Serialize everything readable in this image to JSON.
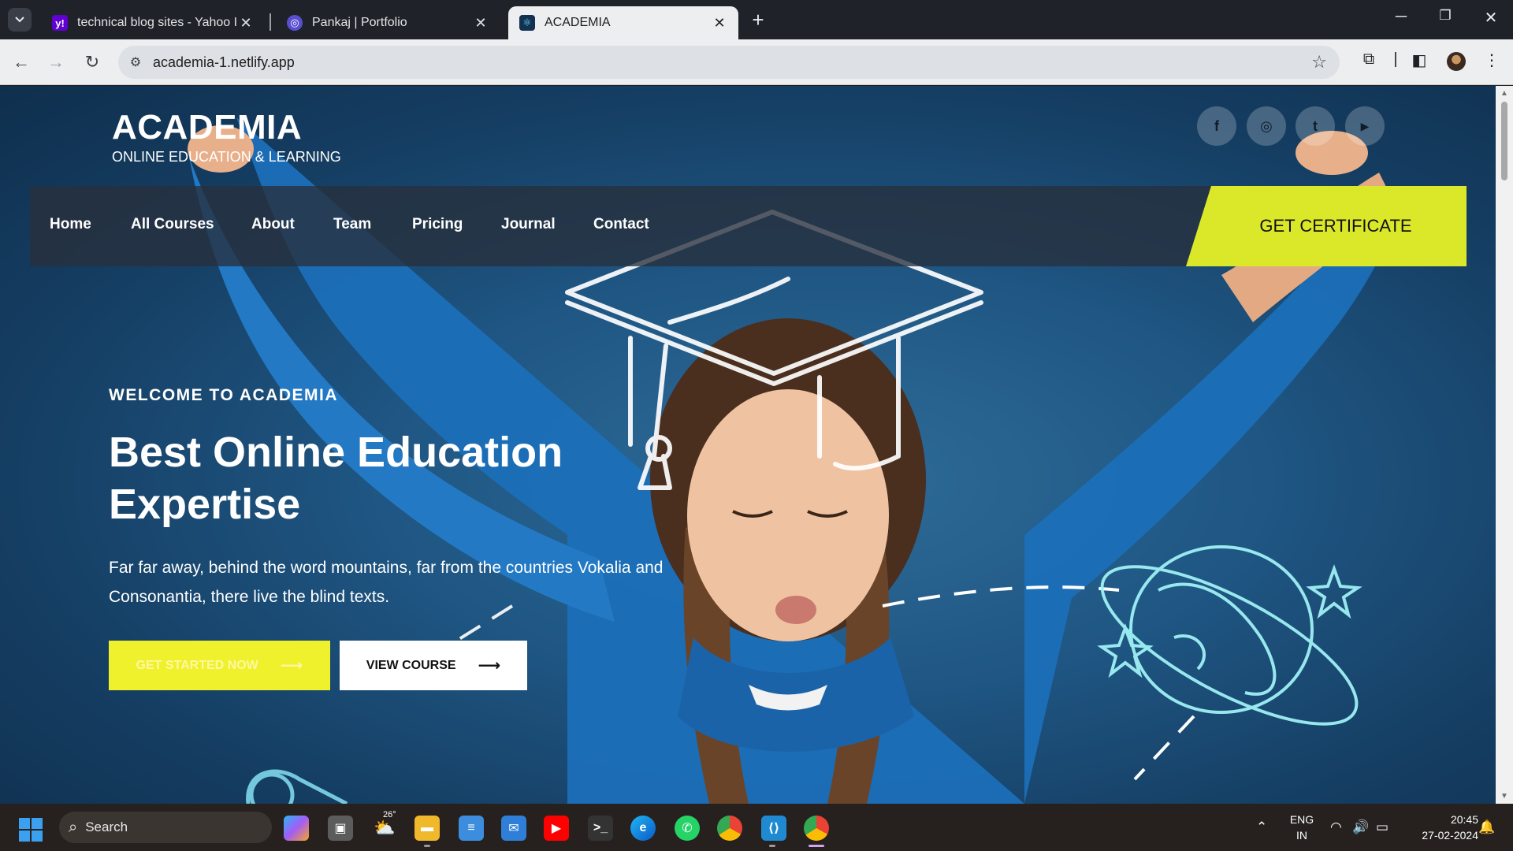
{
  "browser": {
    "tabs": [
      {
        "title": "technical blog sites - Yahoo Ind",
        "favicon": "yahoo-icon"
      },
      {
        "title": "Pankaj | Portfolio",
        "favicon": "portfolio-icon"
      },
      {
        "title": "ACADEMIA",
        "favicon": "react-icon",
        "active": true
      }
    ],
    "url": "academia-1.netlify.app"
  },
  "site": {
    "logo_title": "ACADEMIA",
    "logo_subtitle": "ONLINE EDUCATION & LEARNING",
    "social": [
      "f",
      "◎",
      "t",
      "▶"
    ],
    "nav": [
      "Home",
      "All Courses",
      "About",
      "Team",
      "Pricing",
      "Journal",
      "Contact"
    ],
    "cta": "GET CERTIFICATE",
    "welcome": "WELCOME TO ACADEMIA",
    "headline": "Best Online Education Expertise",
    "lead": "Far far away, behind the word mountains, far from the countries Vokalia and Consonantia, there live the blind texts.",
    "btn_start": "GET STARTED NOW",
    "btn_view": "VIEW COURSE",
    "colors": {
      "accent": "#dbe82a",
      "hero_bg": "#1f5683"
    }
  },
  "taskbar": {
    "search": "Search",
    "weather": "26°",
    "lang_top": "ENG",
    "lang_bottom": "IN",
    "time": "20:45",
    "date": "27-02-2024"
  }
}
